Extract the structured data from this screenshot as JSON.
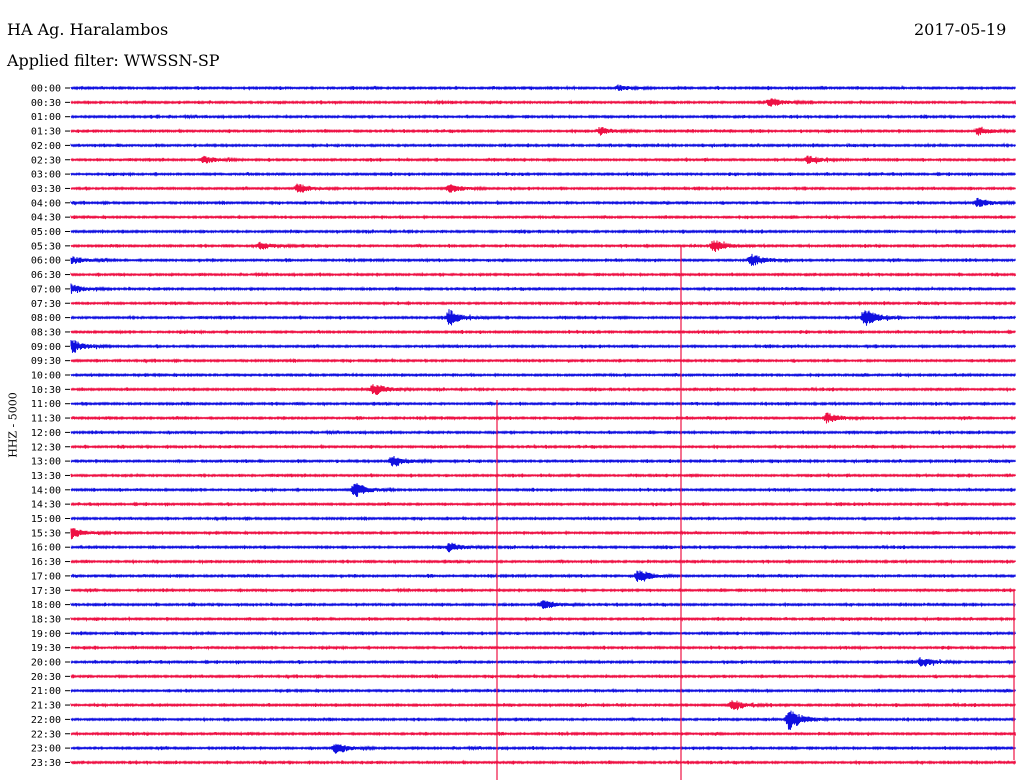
{
  "header": {
    "station": "HA Ag. Haralambos",
    "date": "2017-05-19",
    "filter_label": "Applied filter:",
    "filter_value": "WWSSN-SP"
  },
  "chart_data": {
    "type": "line",
    "title": "HA Ag. Haralambos",
    "ylabel": "HHZ - 5000",
    "colors": [
      "#1010e0",
      "#ee1144"
    ],
    "time_labels": [
      "00:00",
      "00:30",
      "01:00",
      "01:30",
      "02:00",
      "02:30",
      "03:00",
      "03:30",
      "04:00",
      "04:30",
      "05:00",
      "05:30",
      "06:00",
      "06:30",
      "07:00",
      "07:30",
      "08:00",
      "08:30",
      "09:00",
      "09:30",
      "10:00",
      "10:30",
      "11:00",
      "11:30",
      "12:00",
      "12:30",
      "13:00",
      "13:30",
      "14:00",
      "14:30",
      "15:00",
      "15:30",
      "16:00",
      "16:30",
      "17:00",
      "17:30",
      "18:00",
      "18:30",
      "19:00",
      "19:30",
      "20:00",
      "20:30",
      "21:00",
      "21:30",
      "22:00",
      "22:30",
      "23:00",
      "23:30"
    ],
    "events": [
      {
        "t": 0.29,
        "amp": 1
      },
      {
        "t": 0.87,
        "amp": 1.5
      },
      {
        "t": 1.78,
        "amp": 1.3
      },
      {
        "t": 1.98,
        "amp": 1.3
      },
      {
        "t": 2.57,
        "amp": 1.3
      },
      {
        "t": 2.89,
        "amp": 1.3
      },
      {
        "t": 3.62,
        "amp": 1.6
      },
      {
        "t": 3.7,
        "amp": 1.4
      },
      {
        "t": 4.48,
        "amp": 1.5
      },
      {
        "t": 5.6,
        "amp": 1.2
      },
      {
        "t": 5.84,
        "amp": 2.0
      },
      {
        "t": 6.36,
        "amp": 2.2
      },
      {
        "t": 6.0,
        "amp": 1.2
      },
      {
        "t": 7.0,
        "amp": 1.5
      },
      {
        "t": 8.2,
        "amp": 2.5
      },
      {
        "t": 8.42,
        "amp": 3.0
      },
      {
        "t": 9.0,
        "amp": 2.2
      },
      {
        "t": 10.66,
        "amp": 2.0
      },
      {
        "t": 11.9,
        "amp": 1.8
      },
      {
        "t": 13.17,
        "amp": 2.0
      },
      {
        "t": 14.15,
        "amp": 2.5
      },
      {
        "t": 15.5,
        "amp": 1.8
      },
      {
        "t": 16.2,
        "amp": 1.5
      },
      {
        "t": 17.3,
        "amp": 2.0
      },
      {
        "t": 18.25,
        "amp": 1.5
      },
      {
        "t": 20.45,
        "amp": 1.5
      },
      {
        "t": 21.85,
        "amp": 1.5
      },
      {
        "t": 22.38,
        "amp": 3.5
      },
      {
        "t": 23.14,
        "amp": 2.0
      }
    ]
  }
}
